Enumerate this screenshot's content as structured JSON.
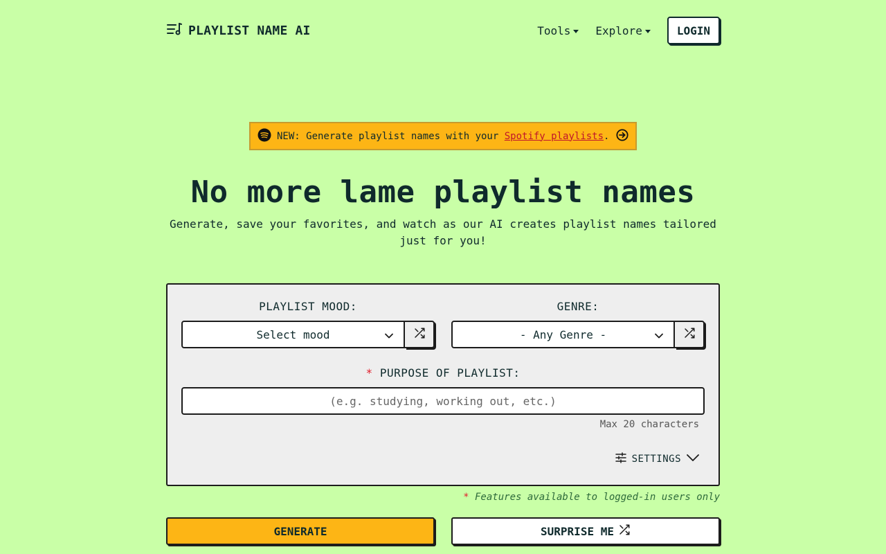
{
  "brand": {
    "name": "PLAYLIST NAME AI",
    "icon": "playlist-music-icon"
  },
  "nav": {
    "tools": "Tools",
    "explore": "Explore",
    "login": "LOGIN"
  },
  "banner": {
    "prefix": "NEW: Generate playlist names with your ",
    "link": "Spotify playlists",
    "suffix": ".",
    "icon": "spotify-icon",
    "arrow_icon": "arrow-right-circle-icon",
    "bg_color": "#fdb515"
  },
  "hero": {
    "title": "No more lame playlist names",
    "subtitle": "Generate, save your favorites, and watch as our AI creates playlist names tailored just for you!"
  },
  "form": {
    "mood_label": "PLAYLIST MOOD:",
    "mood_value": "Select mood",
    "genre_label": "GENRE:",
    "genre_value": "- Any Genre -",
    "purpose_required": "*",
    "purpose_label": "PURPOSE OF PLAYLIST:",
    "purpose_placeholder": "(e.g. studying, working out, etc.)",
    "purpose_value": "",
    "max_hint": "Max 20 characters",
    "settings_label": "SETTINGS"
  },
  "note": {
    "star": "*",
    "text": " Features available to logged-in users only"
  },
  "actions": {
    "generate": "GENERATE",
    "surprise": "SURPRISE ME"
  },
  "colors": {
    "background": "#c9ffa7",
    "accent": "#fdb515",
    "required": "#e11d2a"
  }
}
